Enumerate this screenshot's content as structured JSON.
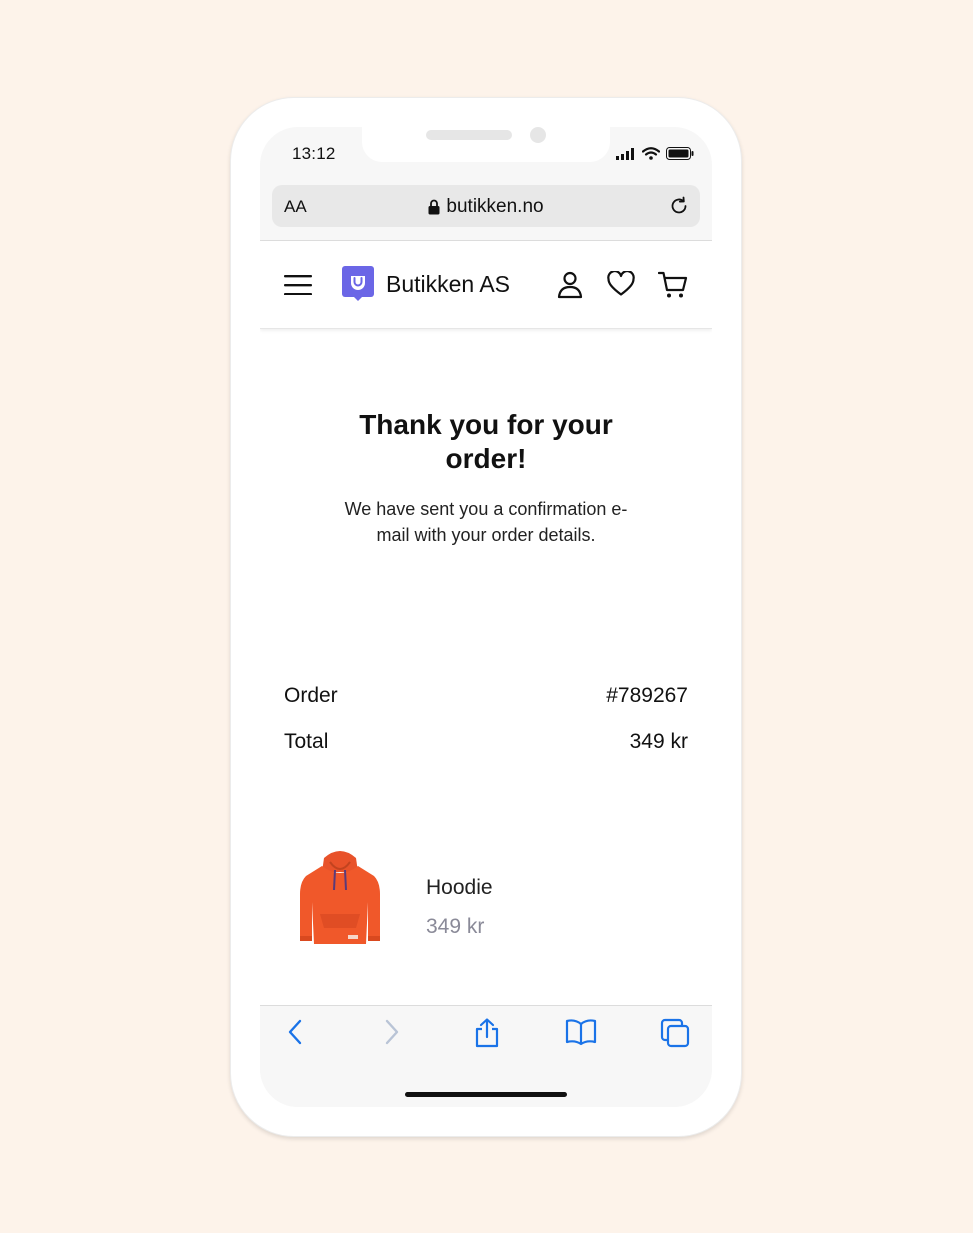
{
  "status_bar": {
    "time": "13:12"
  },
  "browser": {
    "text_size_label": "AA",
    "url": "butikken.no"
  },
  "site": {
    "brand": "Butikken AS",
    "accent_color": "#6b66e6"
  },
  "confirmation": {
    "title": "Thank you for your order!",
    "message": "We have sent you a confirmation e-mail with your order details."
  },
  "summary": [
    {
      "label": "Order",
      "value": "#789267"
    },
    {
      "label": "Total",
      "value": "349 kr"
    }
  ],
  "product": {
    "name": "Hoodie",
    "price": "349 kr",
    "color": "#f0582a"
  },
  "toolbar": {
    "icons": [
      "back-icon",
      "forward-icon",
      "share-icon",
      "bookmarks-icon",
      "tabs-icon"
    ],
    "tint": "#1a73e8"
  }
}
